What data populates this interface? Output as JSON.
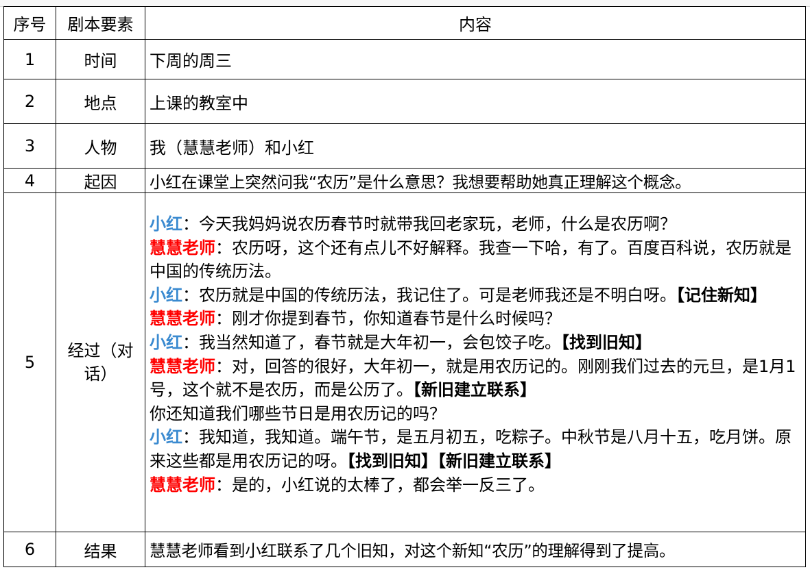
{
  "headers": {
    "no": "序号",
    "element": "剧本要素",
    "content": "内容"
  },
  "rows": [
    {
      "no": "1",
      "element": "时间",
      "content": "下周的周三"
    },
    {
      "no": "2",
      "element": "地点",
      "content": "上课的教室中"
    },
    {
      "no": "3",
      "element": "人物",
      "content": "我（慧慧老师）和小红"
    },
    {
      "no": "4",
      "element": "起因",
      "content": "小红在课堂上突然问我“农历”是什么意思？我想要帮助她真正理解这个概念。"
    },
    {
      "no": "5",
      "element": "经过（对话）"
    },
    {
      "no": "6",
      "element": "结果",
      "content": "慧慧老师看到小红联系了几个旧知，对这个新知“农历”的理解得到了提高。"
    }
  ],
  "dialogue": [
    {
      "speaker": "小红",
      "color": "#3a8ad0",
      "text": "：今天我妈妈说农历春节时就带我回老家玩，老师，什么是农历啊？",
      "tag": ""
    },
    {
      "speaker": "慧慧老师",
      "color": "#ff0000",
      "text": "：农历呀，这个还有点儿不好解释。我查一下哈，有了。百度百科说，农历就是中国的传统历法。",
      "tag": ""
    },
    {
      "speaker": "小红",
      "color": "#3a8ad0",
      "text": "：农历就是中国的传统历法，我记住了。可是老师我还是不明白呀。",
      "tag": "【记住新知】"
    },
    {
      "speaker": "慧慧老师",
      "color": "#ff0000",
      "text": "：刚才你提到春节，你知道春节是什么时候吗？",
      "tag": ""
    },
    {
      "speaker": "小红",
      "color": "#3a8ad0",
      "text": "：我当然知道了，春节就是大年初一，会包饺子吃。",
      "tag": "【找到旧知】"
    },
    {
      "speaker": "慧慧老师",
      "color": "#ff0000",
      "text": "：对，回答的很好，大年初一，就是用农历记的。刚刚我们过去的元旦，是1月1号，这个就不是农历，而是公历了。",
      "tag": "【新旧建立联系】"
    },
    {
      "speaker": "",
      "color": "",
      "text": "你还知道我们哪些节日是用农历记的吗？",
      "tag": ""
    },
    {
      "speaker": "小红",
      "color": "#3a8ad0",
      "text": "：我知道，我知道。端午节，是五月初五，吃粽子。中秋节是八月十五，吃月饼。原来这些都是用农历记的呀。",
      "tag": "【找到旧知】【新旧建立联系】"
    },
    {
      "speaker": "慧慧老师",
      "color": "#ff0000",
      "text": "：是的，小红说的太棒了，都会举一反三了。",
      "tag": ""
    }
  ]
}
